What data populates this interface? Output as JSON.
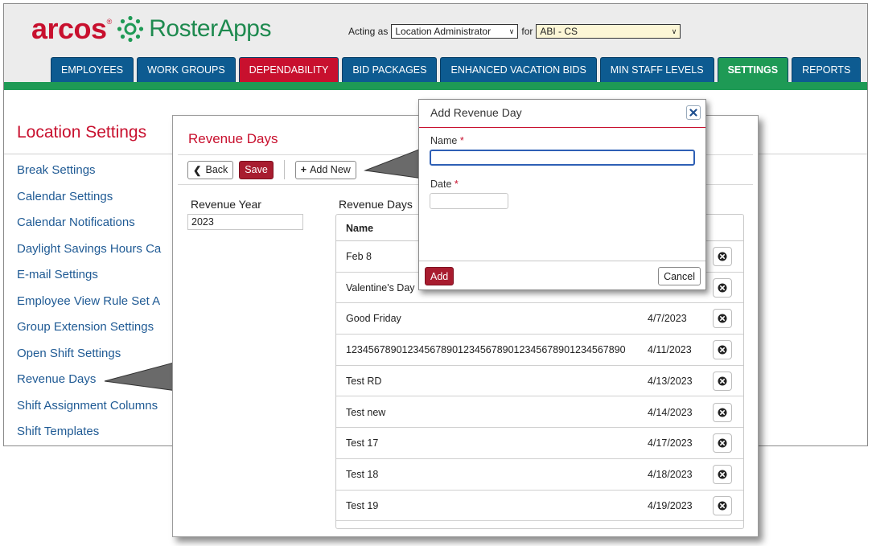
{
  "brand": {
    "logo_word": "arcos",
    "trademark": "®",
    "product": "RosterApps",
    "green": "#1e9a55",
    "red": "#c8102e",
    "blue": "#0d5b91"
  },
  "header": {
    "acting_as_label": "Acting as",
    "role_value": "Location Administrator",
    "for_label": "for",
    "location_value": "ABI - CS"
  },
  "nav": {
    "tabs": [
      {
        "label": "EMPLOYEES",
        "style": "blue"
      },
      {
        "label": "WORK GROUPS",
        "style": "blue"
      },
      {
        "label": "DEPENDABILITY",
        "style": "red"
      },
      {
        "label": "BID PACKAGES",
        "style": "blue"
      },
      {
        "label": "ENHANCED VACATION BIDS",
        "style": "blue"
      },
      {
        "label": "MIN STAFF LEVELS",
        "style": "blue"
      },
      {
        "label": "SETTINGS",
        "style": "green",
        "active": true
      },
      {
        "label": "REPORTS",
        "style": "blue"
      }
    ]
  },
  "location_settings": {
    "title": "Location Settings",
    "items": [
      "Break Settings",
      "Calendar Settings",
      "Calendar Notifications",
      "Daylight Savings Hours Ca",
      "E-mail Settings",
      "Employee View Rule Set A",
      "Group Extension Settings",
      "Open Shift Settings",
      "Revenue Days",
      "Shift Assignment Columns",
      "Shift Templates"
    ]
  },
  "revenue_panel": {
    "title": "Revenue Days",
    "back_label": "Back",
    "save_label": "Save",
    "add_new_label": "Add New",
    "revenue_year_label": "Revenue Year",
    "revenue_year_value": "2023",
    "revenue_days_label": "Revenue Days",
    "table": {
      "name_header": "Name",
      "rows": [
        {
          "name": "Feb 8",
          "date": ""
        },
        {
          "name": "Valentine's Day",
          "date": ""
        },
        {
          "name": "Good Friday",
          "date": "4/7/2023"
        },
        {
          "name": "12345678901234567890123456789012345678901234567890",
          "date": "4/11/2023"
        },
        {
          "name": "Test RD",
          "date": "4/13/2023"
        },
        {
          "name": "Test new",
          "date": "4/14/2023"
        },
        {
          "name": "Test 17",
          "date": "4/17/2023"
        },
        {
          "name": "Test 18",
          "date": "4/18/2023"
        },
        {
          "name": "Test 19",
          "date": "4/19/2023"
        }
      ]
    }
  },
  "modal": {
    "title": "Add Revenue Day",
    "name_label": "Name",
    "date_label": "Date",
    "required_mark": "*",
    "name_value": "",
    "date_value": "",
    "add_label": "Add",
    "cancel_label": "Cancel"
  }
}
